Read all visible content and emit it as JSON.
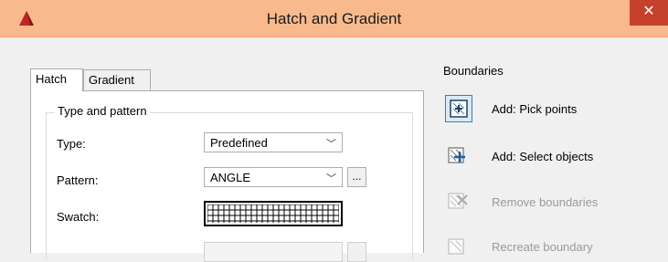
{
  "window": {
    "title": "Hatch and Gradient",
    "close_glyph": "✕"
  },
  "tabs": [
    {
      "label": "Hatch",
      "active": true
    },
    {
      "label": "Gradient",
      "active": false
    }
  ],
  "type_and_pattern": {
    "group_label": "Type and pattern",
    "type_label": "Type:",
    "type_value": "Predefined",
    "pattern_label": "Pattern:",
    "pattern_value": "ANGLE",
    "pattern_browse": "...",
    "swatch_label": "Swatch:"
  },
  "boundaries": {
    "label": "Boundaries",
    "items": [
      {
        "label": "Add: Pick points",
        "icon": "pick-points-icon",
        "enabled": true
      },
      {
        "label": "Add: Select objects",
        "icon": "select-objects-icon",
        "enabled": true
      },
      {
        "label": "Remove boundaries",
        "icon": "remove-boundaries-icon",
        "enabled": false
      },
      {
        "label": "Recreate boundary",
        "icon": "recreate-boundary-icon",
        "enabled": false
      }
    ]
  },
  "colors": {
    "titlebar": "#f8ba8c",
    "close": "#c7402b",
    "accent": "#3c7fb1"
  }
}
